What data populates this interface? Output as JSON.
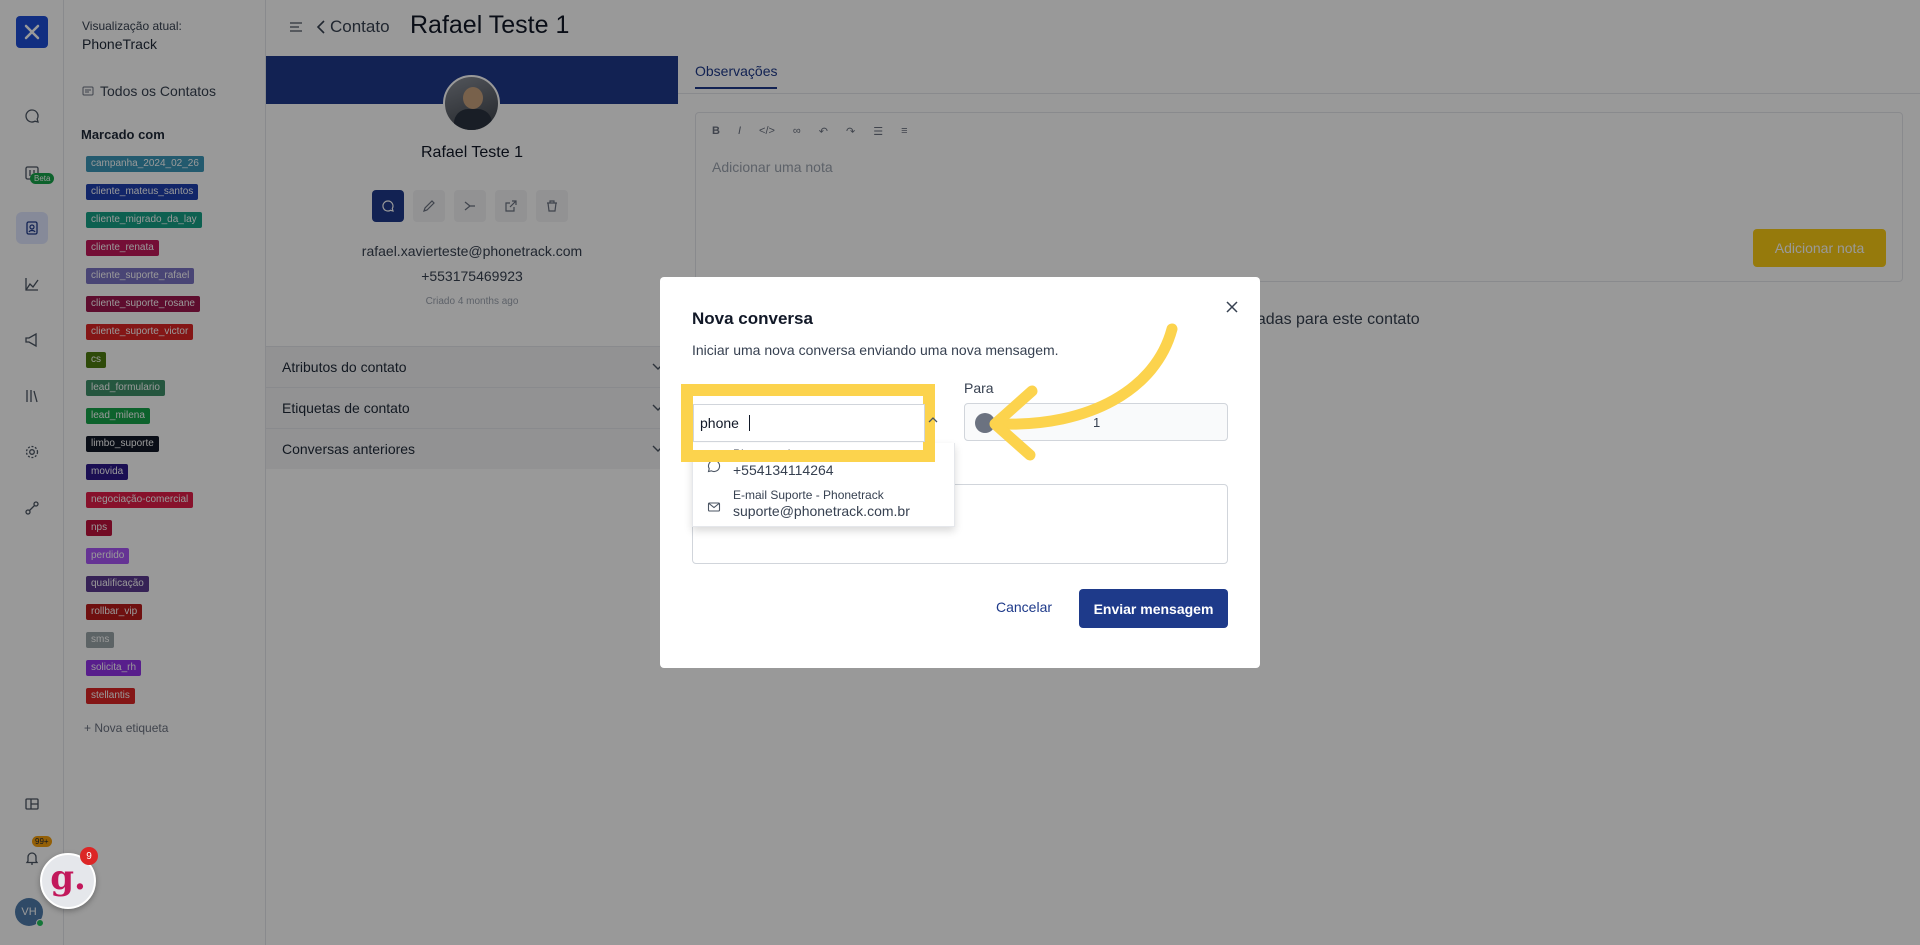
{
  "rail": {
    "icons": [
      "logo-icon",
      "chat-icon",
      "kanban-icon",
      "contacts-icon",
      "reports-icon",
      "campaign-icon",
      "library-icon",
      "settings-icon",
      "integrations-icon",
      "dashboard-icon",
      "bell-icon"
    ],
    "beta_badge": "Beta",
    "bell_badge": "99+",
    "avatar_initials": "VH"
  },
  "widget": {
    "letter": "g.",
    "badge": "9"
  },
  "side": {
    "view_label": "Visualização atual:",
    "view_name": "PhoneTrack",
    "all_contacts": "Todos os Contatos",
    "tagged_heading": "Marcado com",
    "tags": [
      {
        "label": "campanha_2024_02_26",
        "color": "#3b97b8"
      },
      {
        "label": "cliente_mateus_santos",
        "color": "#1e40af"
      },
      {
        "label": "cliente_migrado_da_lay",
        "color": "#16a085"
      },
      {
        "label": "cliente_renata",
        "color": "#c2185b"
      },
      {
        "label": "cliente_suporte_rafael",
        "color": "#7b73c4"
      },
      {
        "label": "cliente_suporte_rosane",
        "color": "#9d174d"
      },
      {
        "label": "cliente_suporte_victor",
        "color": "#dc2626"
      },
      {
        "label": "cs",
        "color": "#4d7c0f"
      },
      {
        "label": "lead_formulario",
        "color": "#3f8f6a"
      },
      {
        "label": "lead_milena",
        "color": "#16a34a"
      },
      {
        "label": "limbo_suporte",
        "color": "#111827"
      },
      {
        "label": "movida",
        "color": "#2e1a8a"
      },
      {
        "label": "negociação-comercial",
        "color": "#e11d48"
      },
      {
        "label": "nps",
        "color": "#be123c"
      },
      {
        "label": "perdido",
        "color": "#a855f7"
      },
      {
        "label": "qualificação",
        "color": "#5b3a8f"
      },
      {
        "label": "rollbar_vip",
        "color": "#b91c1c"
      },
      {
        "label": "sms",
        "color": "#9aa5a8"
      },
      {
        "label": "solicita_rh",
        "color": "#9333ea"
      },
      {
        "label": "stellantis",
        "color": "#dc2626"
      }
    ],
    "new_tag": "+ Nova etiqueta"
  },
  "header": {
    "back_label": "Contato",
    "title": "Rafael Teste 1"
  },
  "contact": {
    "name": "Rafael Teste 1",
    "email": "rafael.xavierteste@phonetrack.com",
    "phone": "+553175469923",
    "created": "Criado 4 months ago",
    "accordions": [
      "Atributos do contato",
      "Etiquetas de contato",
      "Conversas anteriores"
    ]
  },
  "notes": {
    "tab": "Observações",
    "toolbar": [
      "B",
      "I",
      "</>",
      "∞",
      "↶",
      "↷",
      "☰",
      "≡"
    ],
    "placeholder": "Adicionar uma nota",
    "add_button": "Adicionar nota",
    "no_conversations": "criadas para este contato"
  },
  "modal": {
    "title": "Nova conversa",
    "description": "Iniciar uma nova conversa enviando uma nova mensagem.",
    "to_label": "Para",
    "to_value": "1",
    "search_value": "phone",
    "options": [
      {
        "name": "Phonetrack",
        "value": "+554134114264",
        "icon": "whatsapp-icon"
      },
      {
        "name": "E-mail Suporte - Phonetrack",
        "value": "suporte@phonetrack.com.br",
        "icon": "mail-icon"
      }
    ],
    "cancel": "Cancelar",
    "send": "Enviar mensagem"
  },
  "colors": {
    "primary": "#1e3a8a",
    "highlight": "#fcd34d",
    "add_note": "#facc15"
  }
}
